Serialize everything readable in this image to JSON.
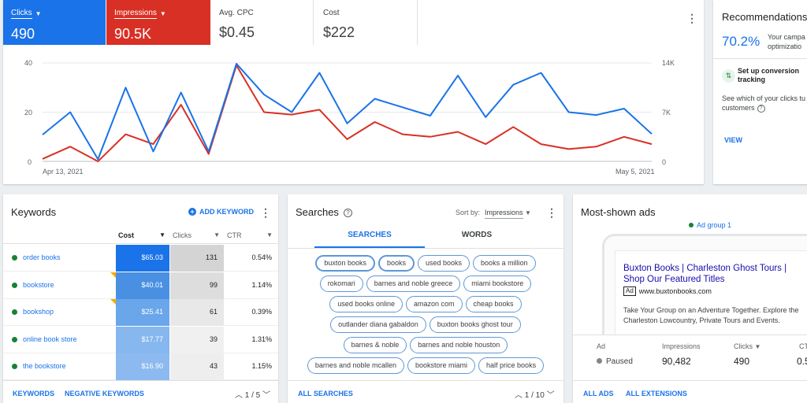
{
  "overview": {
    "metrics": [
      {
        "label": "Clicks",
        "value": "490"
      },
      {
        "label": "Impressions",
        "value": "90.5K"
      },
      {
        "label": "Avg. CPC",
        "value": "$0.45"
      },
      {
        "label": "Cost",
        "value": "$222"
      }
    ],
    "chart": {
      "left_ticks": [
        "40",
        "20",
        "0"
      ],
      "right_ticks": [
        "14K",
        "7K",
        "0"
      ],
      "x_start": "Apr 13, 2021",
      "x_end": "May 5, 2021"
    }
  },
  "chart_data": {
    "type": "line",
    "xlabel": "",
    "ylabel": "",
    "x": [
      "Apr 13, 2021",
      "",
      "",
      "",
      "",
      "",
      "",
      "",
      "",
      "",
      "",
      "",
      "",
      "",
      "",
      "",
      "",
      "",
      "",
      "",
      "",
      "",
      "May 5, 2021"
    ],
    "y_left_lim": [
      0,
      40
    ],
    "y_right_lim": [
      0,
      14000
    ],
    "series": [
      {
        "color": "#d93025",
        "axis": "left",
        "values": [
          1,
          6,
          0,
          11,
          7,
          23,
          3,
          39,
          20,
          19,
          21,
          9,
          16,
          11,
          10,
          12,
          7,
          14,
          7,
          5,
          6,
          10,
          7
        ]
      },
      {
        "color": "#1a73e8",
        "axis": "right",
        "values": [
          3800,
          7000,
          300,
          10500,
          1400,
          9800,
          1400,
          13900,
          9500,
          7000,
          12600,
          5400,
          8900,
          7700,
          6500,
          12200,
          6300,
          10900,
          12600,
          7000,
          6600,
          7500,
          3900
        ]
      }
    ]
  },
  "recommendations": {
    "title": "Recommendations",
    "score": "70.2%",
    "score_desc_1": "Your campa",
    "score_desc_2": "optimizatio",
    "item_title_1": "Set up conversion",
    "item_title_2": "tracking",
    "item_body_1": "See which of your clicks tu",
    "item_body_2": "customers",
    "view": "VIEW"
  },
  "keywords": {
    "title": "Keywords",
    "add": "ADD KEYWORD",
    "headers": {
      "cost": "Cost",
      "clicks": "Clicks",
      "ctr": "CTR"
    },
    "rows": [
      {
        "name": "order books",
        "cost": "$65.03",
        "clicks": "131",
        "ctr": "0.54%",
        "cost_color": "#1a73e8",
        "clicks_color": "#d4d4d4"
      },
      {
        "name": "bookstore",
        "cost": "$40.01",
        "clicks": "99",
        "ctr": "1.14%",
        "cost_color": "#4a90e2",
        "clicks_color": "#dddddd"
      },
      {
        "name": "bookshop",
        "cost": "$25.41",
        "clicks": "61",
        "ctr": "0.39%",
        "cost_color": "#6aa6ea",
        "clicks_color": "#e8e8e8"
      },
      {
        "name": "online book store",
        "cost": "$17.77",
        "clicks": "39",
        "ctr": "1.31%",
        "cost_color": "#86b7ef",
        "clicks_color": "#f0f0f0"
      },
      {
        "name": "the bookstore",
        "cost": "$16.90",
        "clicks": "43",
        "ctr": "1.15%",
        "cost_color": "#8cbaf0",
        "clicks_color": "#eeeeee"
      }
    ],
    "footer": {
      "link1": "KEYWORDS",
      "link2": "NEGATIVE KEYWORDS",
      "pager": "1 / 5"
    }
  },
  "searches": {
    "title": "Searches",
    "sort_label": "Sort by:",
    "sort_value": "Impressions",
    "tabs": [
      "SEARCHES",
      "WORDS"
    ],
    "chip_rows": [
      [
        "buxton books",
        "books",
        "used books",
        "books a million"
      ],
      [
        "rokomari",
        "barnes and noble greece",
        "miami bookstore"
      ],
      [
        "used books online",
        "amazon com",
        "cheap books"
      ],
      [
        "outlander diana gabaldon",
        "buxton books ghost tour"
      ],
      [
        "barnes & noble",
        "barnes and noble houston"
      ],
      [
        "barnes and noble mcallen",
        "bookstore miami",
        "half price books"
      ]
    ],
    "footer": {
      "link": "ALL SEARCHES",
      "pager": "1 / 10"
    }
  },
  "ads": {
    "title": "Most-shown ads",
    "ad_group": "Ad group 1",
    "headline": "Buxton Books | Charleston Ghost Tours | Shop Our Featured Titles",
    "badge": "Ad",
    "url": "www.buxtonbooks.com",
    "description": "Take Your Group on an Adventure Together. Explore the Charleston Lowcountry, Private Tours and Events.",
    "table": {
      "col_ad": "Ad",
      "col_impr": "Impressions",
      "col_clicks": "Clicks",
      "col_ctr": "CT",
      "status": "Paused",
      "impr": "90,482",
      "clicks": "490",
      "ctr": "0.5"
    },
    "footer": {
      "link1": "ALL ADS",
      "link2": "ALL EXTENSIONS"
    }
  }
}
